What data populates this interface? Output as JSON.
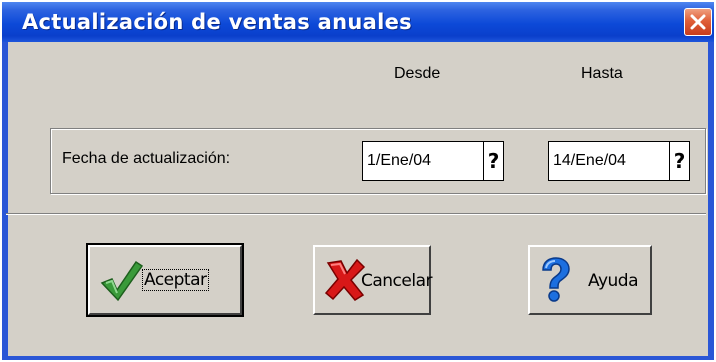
{
  "window": {
    "title": "Actualización de ventas anuales",
    "close_icon": "close-icon"
  },
  "columns": {
    "from_label": "Desde",
    "to_label": "Hasta"
  },
  "date_range": {
    "label": "Fecha de actualización:",
    "from_value": "1/Ene/04",
    "to_value": "14/Ene/04",
    "picker_glyph": "?"
  },
  "buttons": {
    "accept": {
      "label": "Aceptar",
      "icon": "checkmark-icon",
      "color": "#2f8f2f"
    },
    "cancel": {
      "label": "Cancelar",
      "icon": "red-x-icon",
      "color": "#d01010"
    },
    "help": {
      "label": "Ayuda",
      "icon": "question-mark-icon",
      "color": "#1c6fe0"
    }
  },
  "colors": {
    "titlebar": "#0c49d8",
    "dialog_face": "#d4d0c8",
    "close_button": "#e0603a"
  }
}
